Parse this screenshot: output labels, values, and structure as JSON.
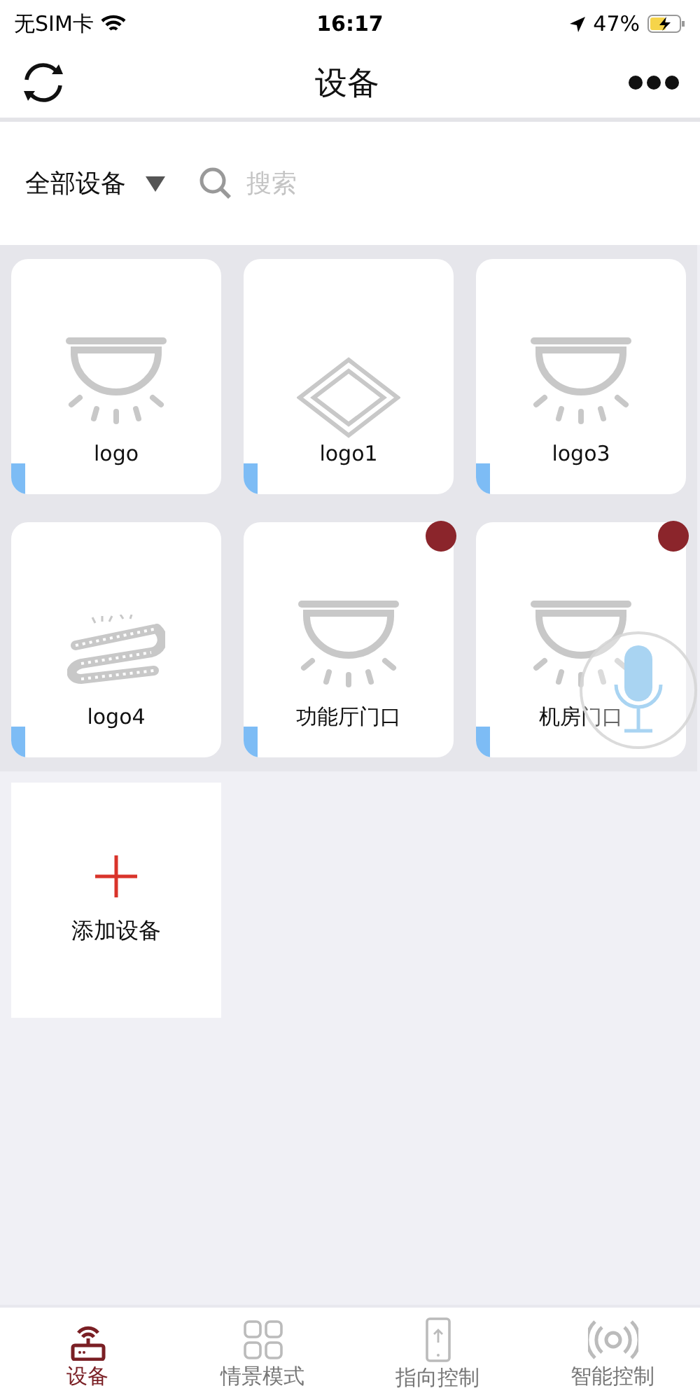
{
  "status_bar": {
    "carrier": "无SIM卡",
    "time": "16:17",
    "battery": "47%"
  },
  "header": {
    "title": "设备"
  },
  "filter": {
    "category": "全部设备",
    "search_placeholder": "搜索"
  },
  "devices": [
    {
      "name": "logo",
      "kind": "lamp",
      "online": true,
      "alert": false
    },
    {
      "name": "logo1",
      "kind": "panel",
      "online": true,
      "alert": false
    },
    {
      "name": "logo3",
      "kind": "lamp",
      "online": true,
      "alert": false
    },
    {
      "name": "logo4",
      "kind": "strip",
      "online": true,
      "alert": false
    },
    {
      "name": "功能厅门口",
      "kind": "lamp",
      "online": true,
      "alert": true
    },
    {
      "name": "机房门口",
      "kind": "lamp",
      "online": true,
      "alert": true
    }
  ],
  "add_device": {
    "label": "添加设备"
  },
  "tabs": [
    {
      "label": "设备",
      "kind": "router",
      "selected": true
    },
    {
      "label": "情景模式",
      "kind": "grid",
      "selected": false
    },
    {
      "label": "指向控制",
      "kind": "phone",
      "selected": false
    },
    {
      "label": "智能控制",
      "kind": "signal",
      "selected": false
    }
  ]
}
